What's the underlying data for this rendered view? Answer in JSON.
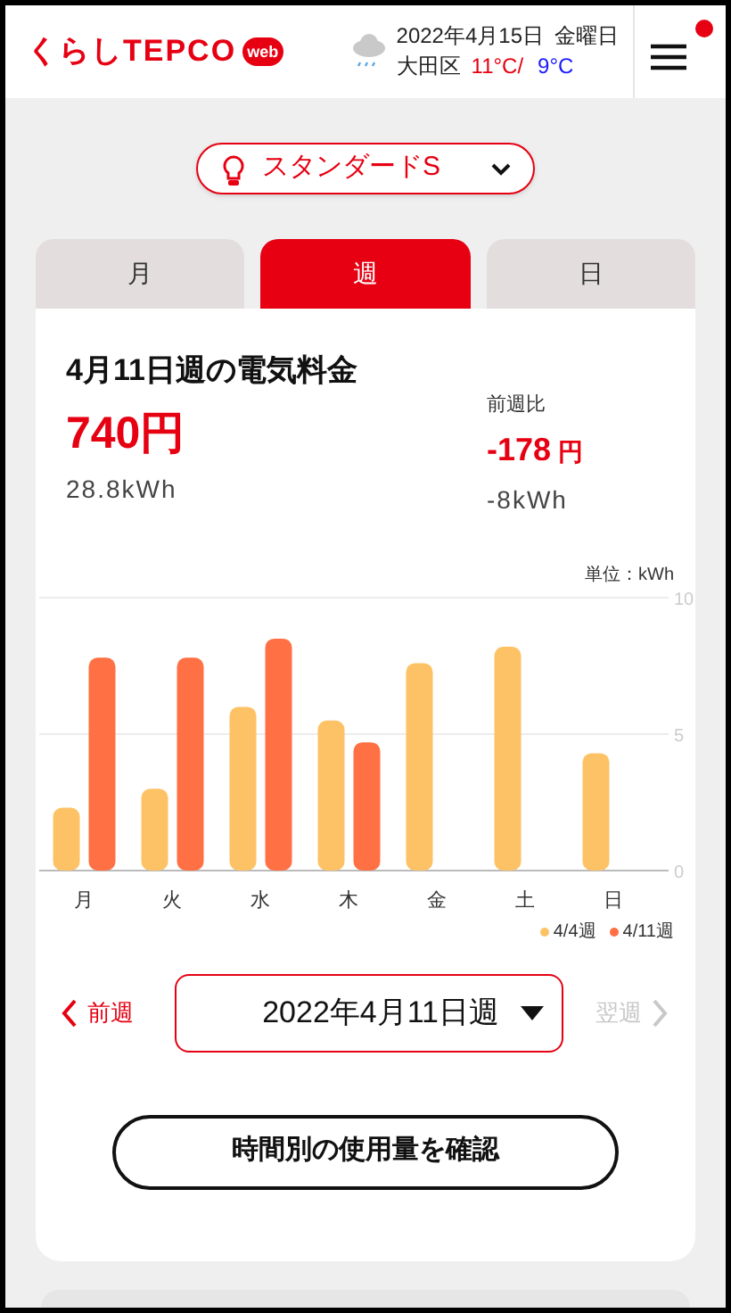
{
  "header": {
    "logo": "くらしTEPCO",
    "logo_badge": "web",
    "date": "2022年4月15日",
    "weekday": "金曜日",
    "area": "大田区",
    "high": "11°C/",
    "low": "9°C",
    "menu_notification": true
  },
  "plan": {
    "label": "スタンダードS"
  },
  "tabs": [
    {
      "label": "月",
      "selected": false
    },
    {
      "label": "週",
      "selected": true
    },
    {
      "label": "日",
      "selected": false
    }
  ],
  "summary": {
    "title": "4月11日週の電気料金",
    "cost": "740円",
    "usage": "28.8kWh",
    "compare_label": "前週比",
    "cost_diff": "-178",
    "cost_diff_unit": "円",
    "usage_diff": "-8kWh"
  },
  "unit_label": "単位：kWh",
  "chart_data": {
    "type": "bar",
    "categories": [
      "月",
      "火",
      "水",
      "木",
      "金",
      "土",
      "日"
    ],
    "ylim": [
      0,
      10
    ],
    "yticks": [
      0,
      5,
      10
    ],
    "series": [
      {
        "name": "4/4週",
        "color": "#fdc265",
        "values": [
          2.3,
          3.0,
          6.0,
          5.5,
          7.6,
          8.2,
          4.3
        ]
      },
      {
        "name": "4/11週",
        "color": "#ff7044",
        "values": [
          7.8,
          7.8,
          8.5,
          4.7,
          null,
          null,
          null
        ]
      }
    ]
  },
  "week_nav": {
    "prev": "前週",
    "prev_disabled": false,
    "current": "2022年4月11日週",
    "next": "翌週",
    "next_disabled": true
  },
  "hourly_button": "時間別の使用量を確認"
}
